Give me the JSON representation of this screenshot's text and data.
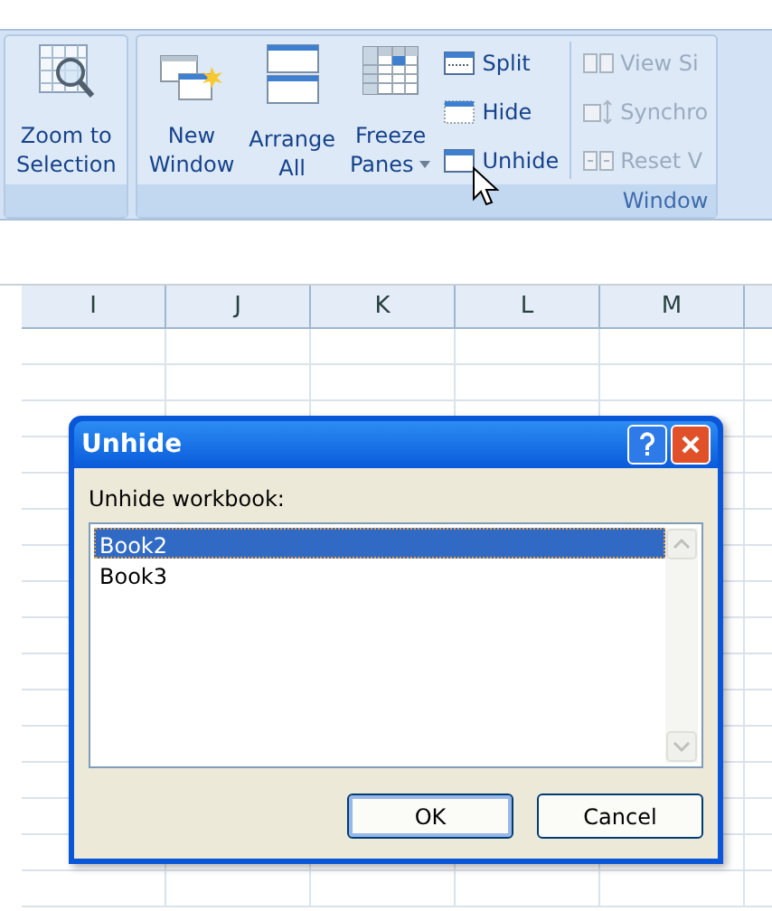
{
  "ribbon": {
    "groups": [
      {
        "large_buttons": [
          {
            "kind": "zoom",
            "label_lines": [
              "Zoom to",
              "Selection"
            ],
            "dropdown": false
          }
        ]
      },
      {
        "label": "Window",
        "large_buttons": [
          {
            "kind": "new-window",
            "label_lines": [
              "New",
              "Window"
            ],
            "dropdown": false
          },
          {
            "kind": "arrange",
            "label_lines": [
              "Arrange",
              "All"
            ],
            "dropdown": false
          },
          {
            "kind": "freeze",
            "label_lines": [
              "Freeze",
              "Panes"
            ],
            "dropdown": true
          }
        ],
        "small_buttons": [
          {
            "kind": "split",
            "label": "Split",
            "disabled": false
          },
          {
            "kind": "hide",
            "label": "Hide",
            "disabled": false
          },
          {
            "kind": "unhide",
            "label": "Unhide",
            "disabled": false
          },
          {
            "kind": "side",
            "label": "View Si",
            "disabled": true
          },
          {
            "kind": "sync",
            "label": "Synchro",
            "disabled": true
          },
          {
            "kind": "reset",
            "label": "Reset V",
            "disabled": true
          }
        ]
      }
    ]
  },
  "columns": [
    "I",
    "J",
    "K",
    "L",
    "M"
  ],
  "dialog": {
    "title": "Unhide",
    "list_label": "Unhide workbook:",
    "items": [
      {
        "label": "Book2",
        "selected": true
      },
      {
        "label": "Book3",
        "selected": false
      }
    ],
    "buttons": [
      {
        "label": "OK",
        "default": true
      },
      {
        "label": "Cancel",
        "default": false
      }
    ]
  }
}
